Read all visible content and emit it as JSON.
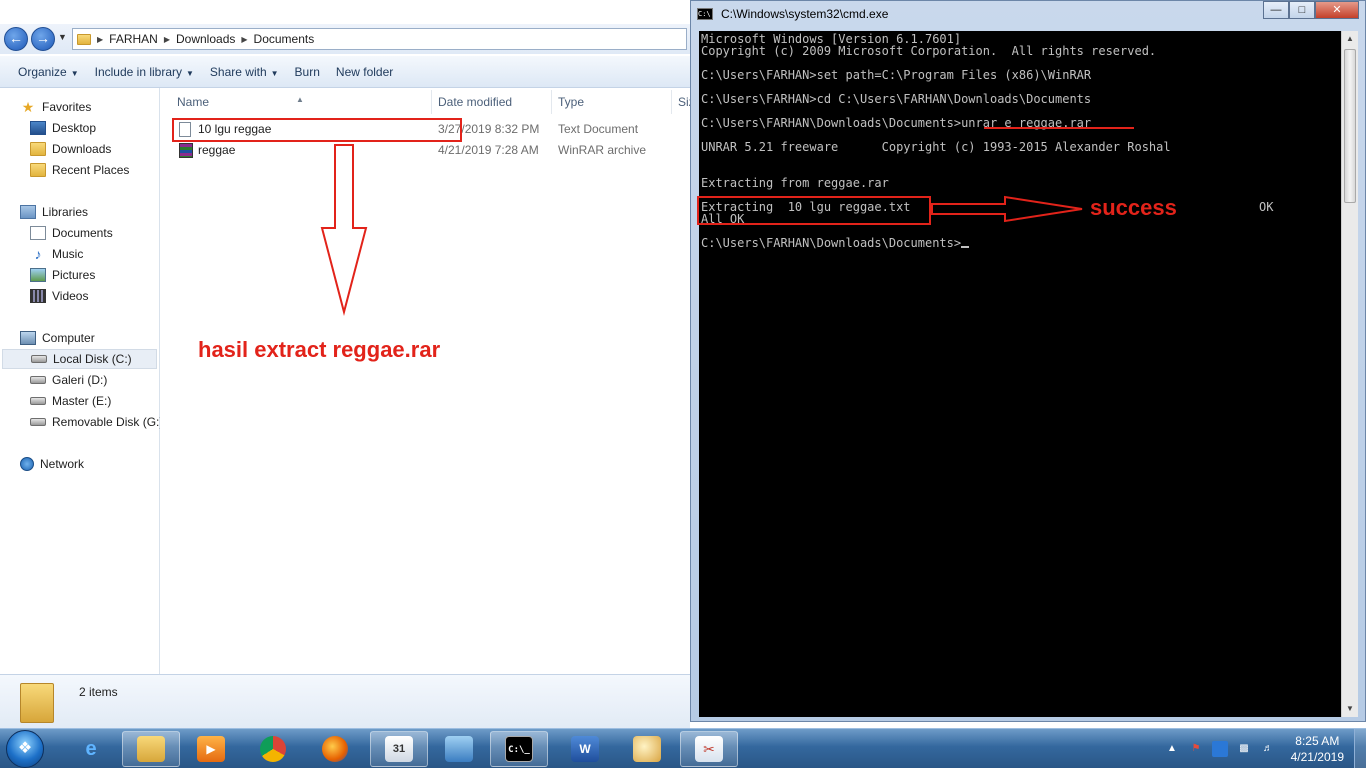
{
  "explorer": {
    "breadcrumb": [
      "FARHAN",
      "Downloads",
      "Documents"
    ],
    "toolbar": [
      "Organize",
      "Include in library",
      "Share with",
      "Burn",
      "New folder"
    ],
    "nav": {
      "favorites_title": "Favorites",
      "favorites": [
        "Desktop",
        "Downloads",
        "Recent Places"
      ],
      "libraries_title": "Libraries",
      "libraries": [
        "Documents",
        "Music",
        "Pictures",
        "Videos"
      ],
      "computer_title": "Computer",
      "drives": [
        "Local Disk (C:)",
        "Galeri (D:)",
        "Master (E:)",
        "Removable Disk (G:)"
      ],
      "network_title": "Network"
    },
    "columns": [
      "Name",
      "Date modified",
      "Type",
      "Siz"
    ],
    "files": [
      {
        "name": "10 lgu reggae",
        "date": "3/27/2019 8:32 PM",
        "type": "Text Document"
      },
      {
        "name": "reggae",
        "date": "4/21/2019 7:28 AM",
        "type": "WinRAR archive"
      }
    ],
    "status": "2 items"
  },
  "cmd": {
    "title": "C:\\Windows\\system32\\cmd.exe",
    "lines": [
      "Microsoft Windows [Version 6.1.7601]",
      "Copyright (c) 2009 Microsoft Corporation.  All rights reserved.",
      "",
      "C:\\Users\\FARHAN>set path=C:\\Program Files (x86)\\WinRAR",
      "",
      "C:\\Users\\FARHAN>cd C:\\Users\\FARHAN\\Downloads\\Documents",
      "",
      "C:\\Users\\FARHAN\\Downloads\\Documents>unrar e reggae.rar",
      "",
      "UNRAR 5.21 freeware      Copyright (c) 1993-2015 Alexander Roshal",
      "",
      "",
      "Extracting from reggae.rar",
      "",
      "Extracting  10 lgu reggae.txt",
      "All OK",
      "",
      "C:\\Users\\FARHAN\\Downloads\\Documents>"
    ],
    "ok_label": "OK"
  },
  "annotations": {
    "left_label": "hasil extract reggae.rar",
    "right_label": "success",
    "color": "#e2231a"
  },
  "taskbar": {
    "time": "8:25 AM",
    "date": "4/21/2019"
  }
}
